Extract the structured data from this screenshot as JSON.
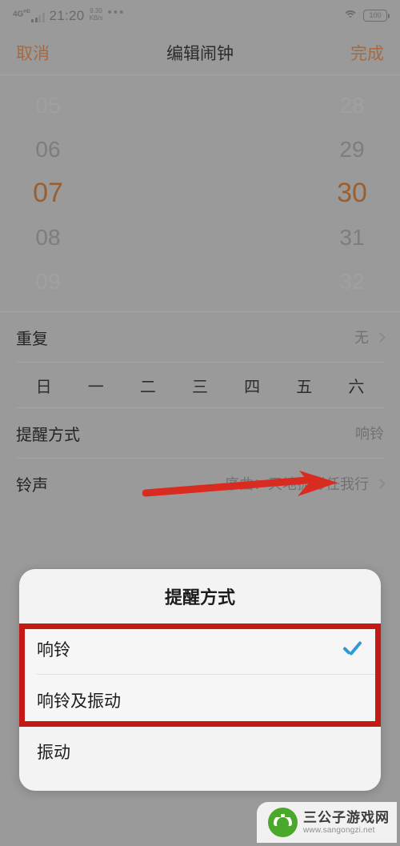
{
  "status_bar": {
    "network_type": "4G",
    "network_sup": "HD",
    "time": "21:20",
    "data_rate_value": "9.30",
    "data_rate_unit": "KB/s",
    "overflow_dots": "•••",
    "wifi_icon": "wifi-icon",
    "battery_level": "100"
  },
  "nav_bar": {
    "cancel_label": "取消",
    "title": "编辑闹钟",
    "done_label": "完成"
  },
  "time_picker": {
    "hours": [
      "05",
      "06",
      "07",
      "08",
      "09"
    ],
    "minutes": [
      "28",
      "29",
      "30",
      "31",
      "32"
    ],
    "selected_hour": "07",
    "selected_minute": "30",
    "selected_color": "#9b5f2f"
  },
  "settings": {
    "repeat": {
      "label": "重复",
      "value": "无",
      "chevron": "chevron-right-icon"
    },
    "weekdays": [
      "日",
      "一",
      "二",
      "三",
      "四",
      "五",
      "六"
    ],
    "reminder": {
      "label": "提醒方式",
      "value": "响铃"
    },
    "ringtone": {
      "label": "铃声",
      "value": "序曲：天地孤影任我行",
      "chevron": "chevron-right-icon"
    }
  },
  "dialog": {
    "title": "提醒方式",
    "options": [
      {
        "label": "响铃",
        "checked": true
      },
      {
        "label": "响铃及振动",
        "checked": false
      },
      {
        "label": "振动",
        "checked": false
      }
    ],
    "check_color": "#2e9ad6"
  },
  "annotation": {
    "arrow_color": "#d92b20",
    "highlight_color": "#c31a16"
  },
  "watermark": {
    "name": "三公子游戏网",
    "url": "www.sangongzi.net"
  }
}
